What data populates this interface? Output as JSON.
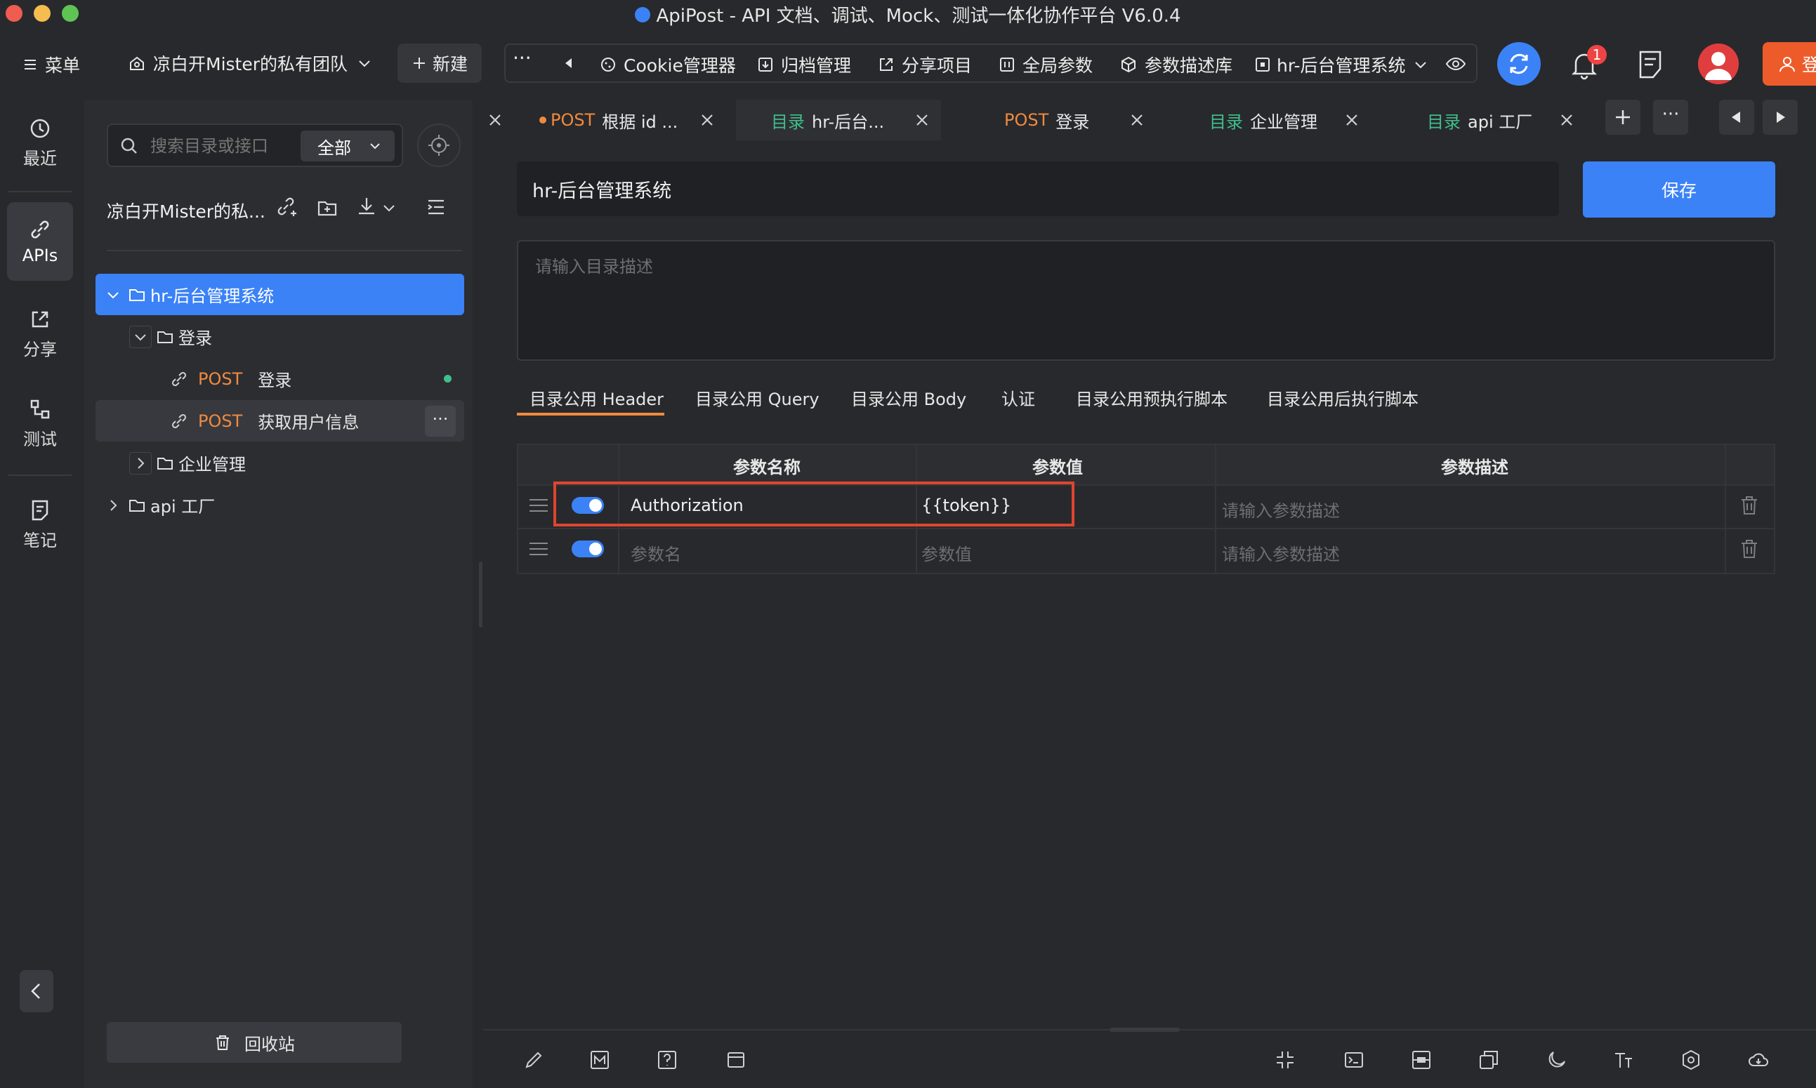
{
  "window": {
    "title": "ApiPost - API 文档、调试、Mock、测试一体化协作平台 V6.0.4"
  },
  "toolbar": {
    "menu_label": "菜单",
    "team_name": "凉白开Mister的私有团队",
    "new_label": "新建",
    "cookie_label": "Cookie管理器",
    "archive_label": "归档管理",
    "share_label": "分享项目",
    "global_params_label": "全局参数",
    "param_lib_label": "参数描述库",
    "env_label": "hr-后台管理系统",
    "notification_count": "1",
    "login_label": "登"
  },
  "rail": {
    "recent": "最近",
    "apis": "APIs",
    "share": "分享",
    "test": "测试",
    "notes": "笔记"
  },
  "tree": {
    "search_placeholder": "搜索目录或接口",
    "filter_label": "全部",
    "project_name": "凉白开Mister的私...",
    "items": [
      {
        "label": "hr-后台管理系统"
      },
      {
        "label": "登录"
      },
      {
        "method": "POST",
        "label": "登录"
      },
      {
        "method": "POST",
        "label": "获取用户信息"
      },
      {
        "label": "企业管理"
      },
      {
        "label": "api 工厂"
      }
    ],
    "recycle_label": "回收站"
  },
  "tabs": [
    {
      "method": "POST",
      "label": "根据 id ..."
    },
    {
      "kind": "目录",
      "label": "hr-后台..."
    },
    {
      "method": "POST",
      "label": "登录"
    },
    {
      "kind": "目录",
      "label": "企业管理"
    },
    {
      "kind": "目录",
      "label": "api 工厂"
    }
  ],
  "editor": {
    "folder_name": "hr-后台管理系统",
    "save_label": "保存",
    "desc_placeholder": "请输入目录描述",
    "subtabs": [
      "目录公用 Header",
      "目录公用 Query",
      "目录公用 Body",
      "认证",
      "目录公用预执行脚本",
      "目录公用后执行脚本"
    ],
    "columns": [
      "参数名称",
      "参数值",
      "参数描述"
    ],
    "rows": [
      {
        "name": "Authorization",
        "value": "{{token}}",
        "desc_placeholder": "请输入参数描述"
      },
      {
        "name_placeholder": "参数名",
        "value_placeholder": "参数值",
        "desc_placeholder": "请输入参数描述"
      }
    ]
  },
  "colors": {
    "accent": "#3b82f6",
    "post": "#f08a3e",
    "folder_tag": "#3fbf8c",
    "highlight_box": "#e0442f"
  }
}
